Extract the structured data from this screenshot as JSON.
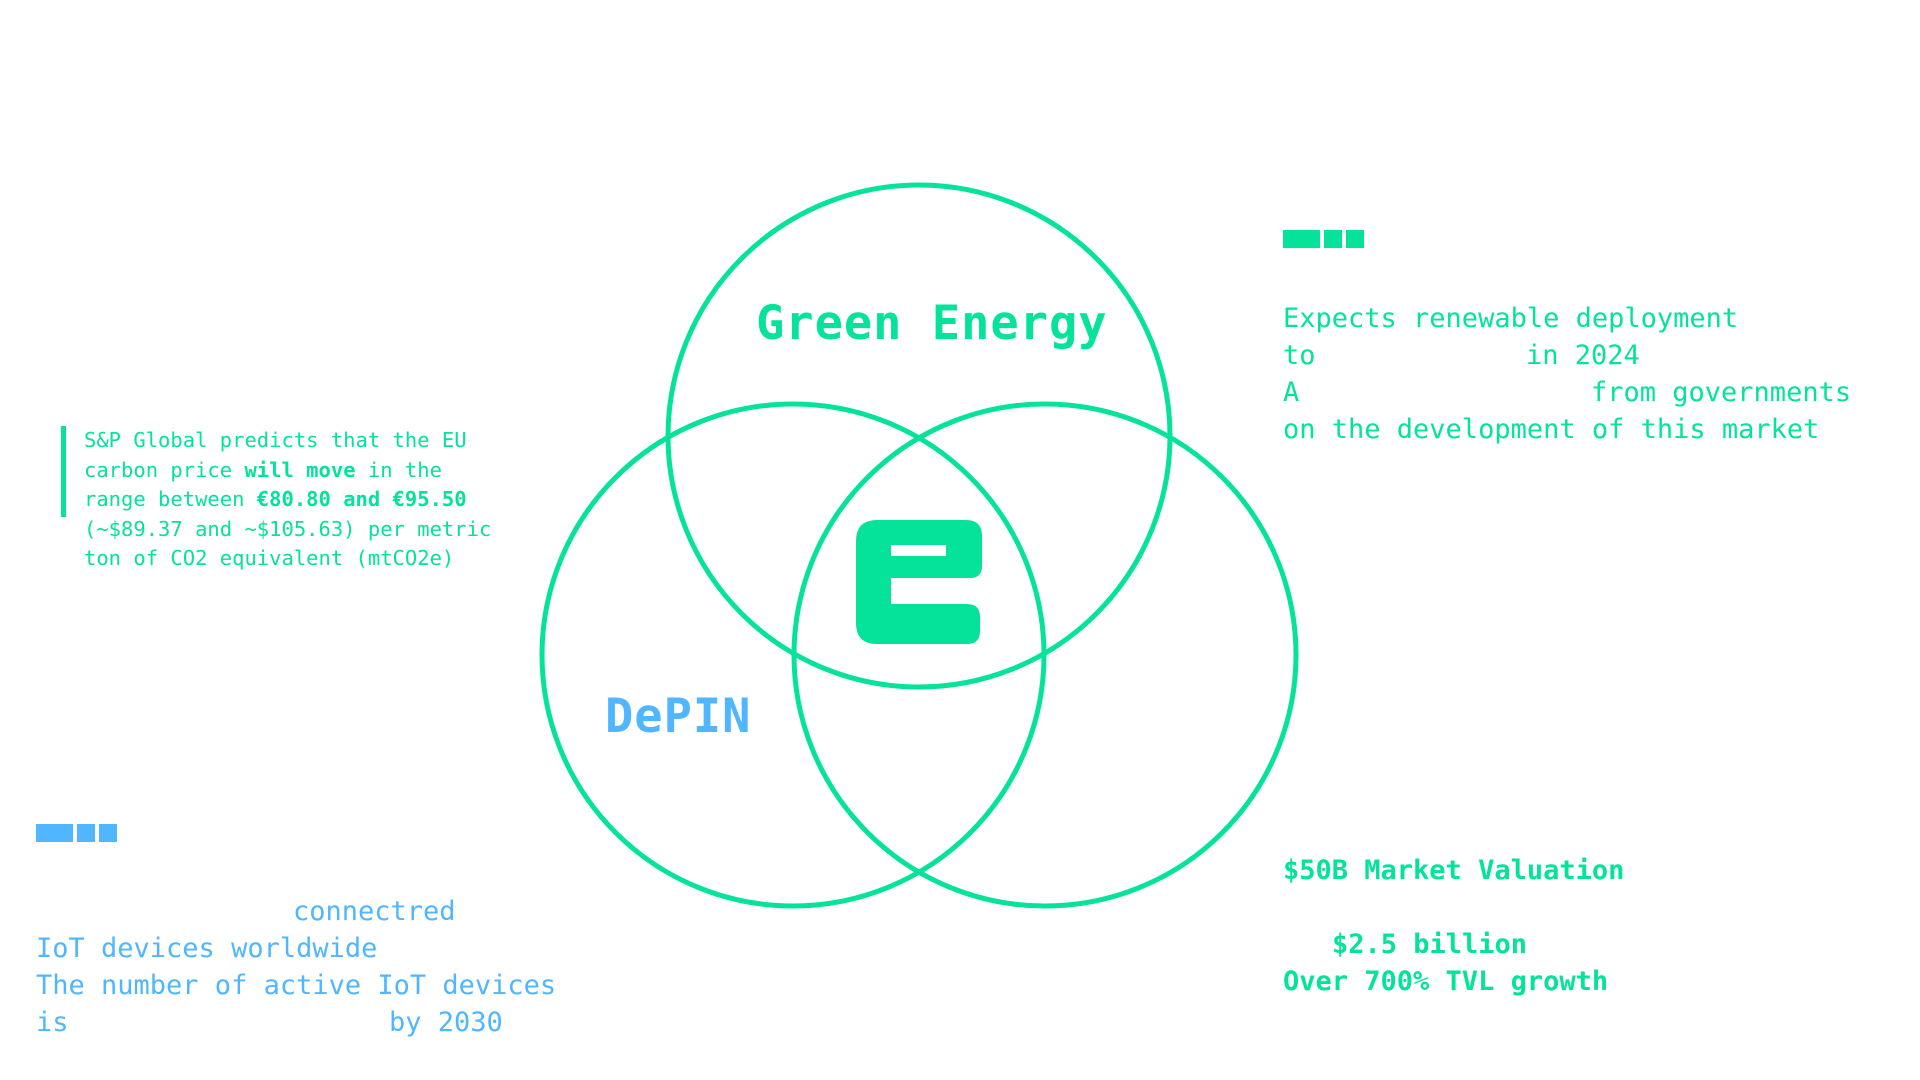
{
  "diagram": {
    "title": "",
    "circles": [
      {
        "name": "top",
        "label": "Green Energy"
      },
      {
        "name": "left",
        "label": "DePIN"
      },
      {
        "name": "right",
        "label": ""
      }
    ],
    "center_logo_icon": "e-logo-icon"
  },
  "colors": {
    "green": "#05e39b",
    "blue": "#4fb6ff",
    "background": "#ffffff"
  },
  "quote": {
    "line1": "S&P Global predicts that the EU",
    "line2_pre": "carbon price ",
    "line2_bold": "will move",
    "line2_post": " in the",
    "line3_pre": "range between ",
    "line3_bold": "€80.80 and €95.50",
    "line4": "(~$89.37 and ~$105.63) per metric",
    "line5": "ton of CO2 equivalent (mtCO2e)"
  },
  "green_stats": {
    "line1": "Expects renewable deployment",
    "line2a": "to",
    "line2b": "in 2024",
    "line3a": "A",
    "line3b": "from governments",
    "line4": "on the development of this market"
  },
  "market_stats": {
    "valuation": "$50B Market Valuation",
    "amount": "$2.5 billion",
    "growth": "Over 700% TVL growth"
  },
  "iot_stats": {
    "line1": "connectred",
    "line2": "IoT devices worldwide",
    "line3": "The number of active IoT devices",
    "line4a": "is",
    "line4b": "by 2030"
  }
}
